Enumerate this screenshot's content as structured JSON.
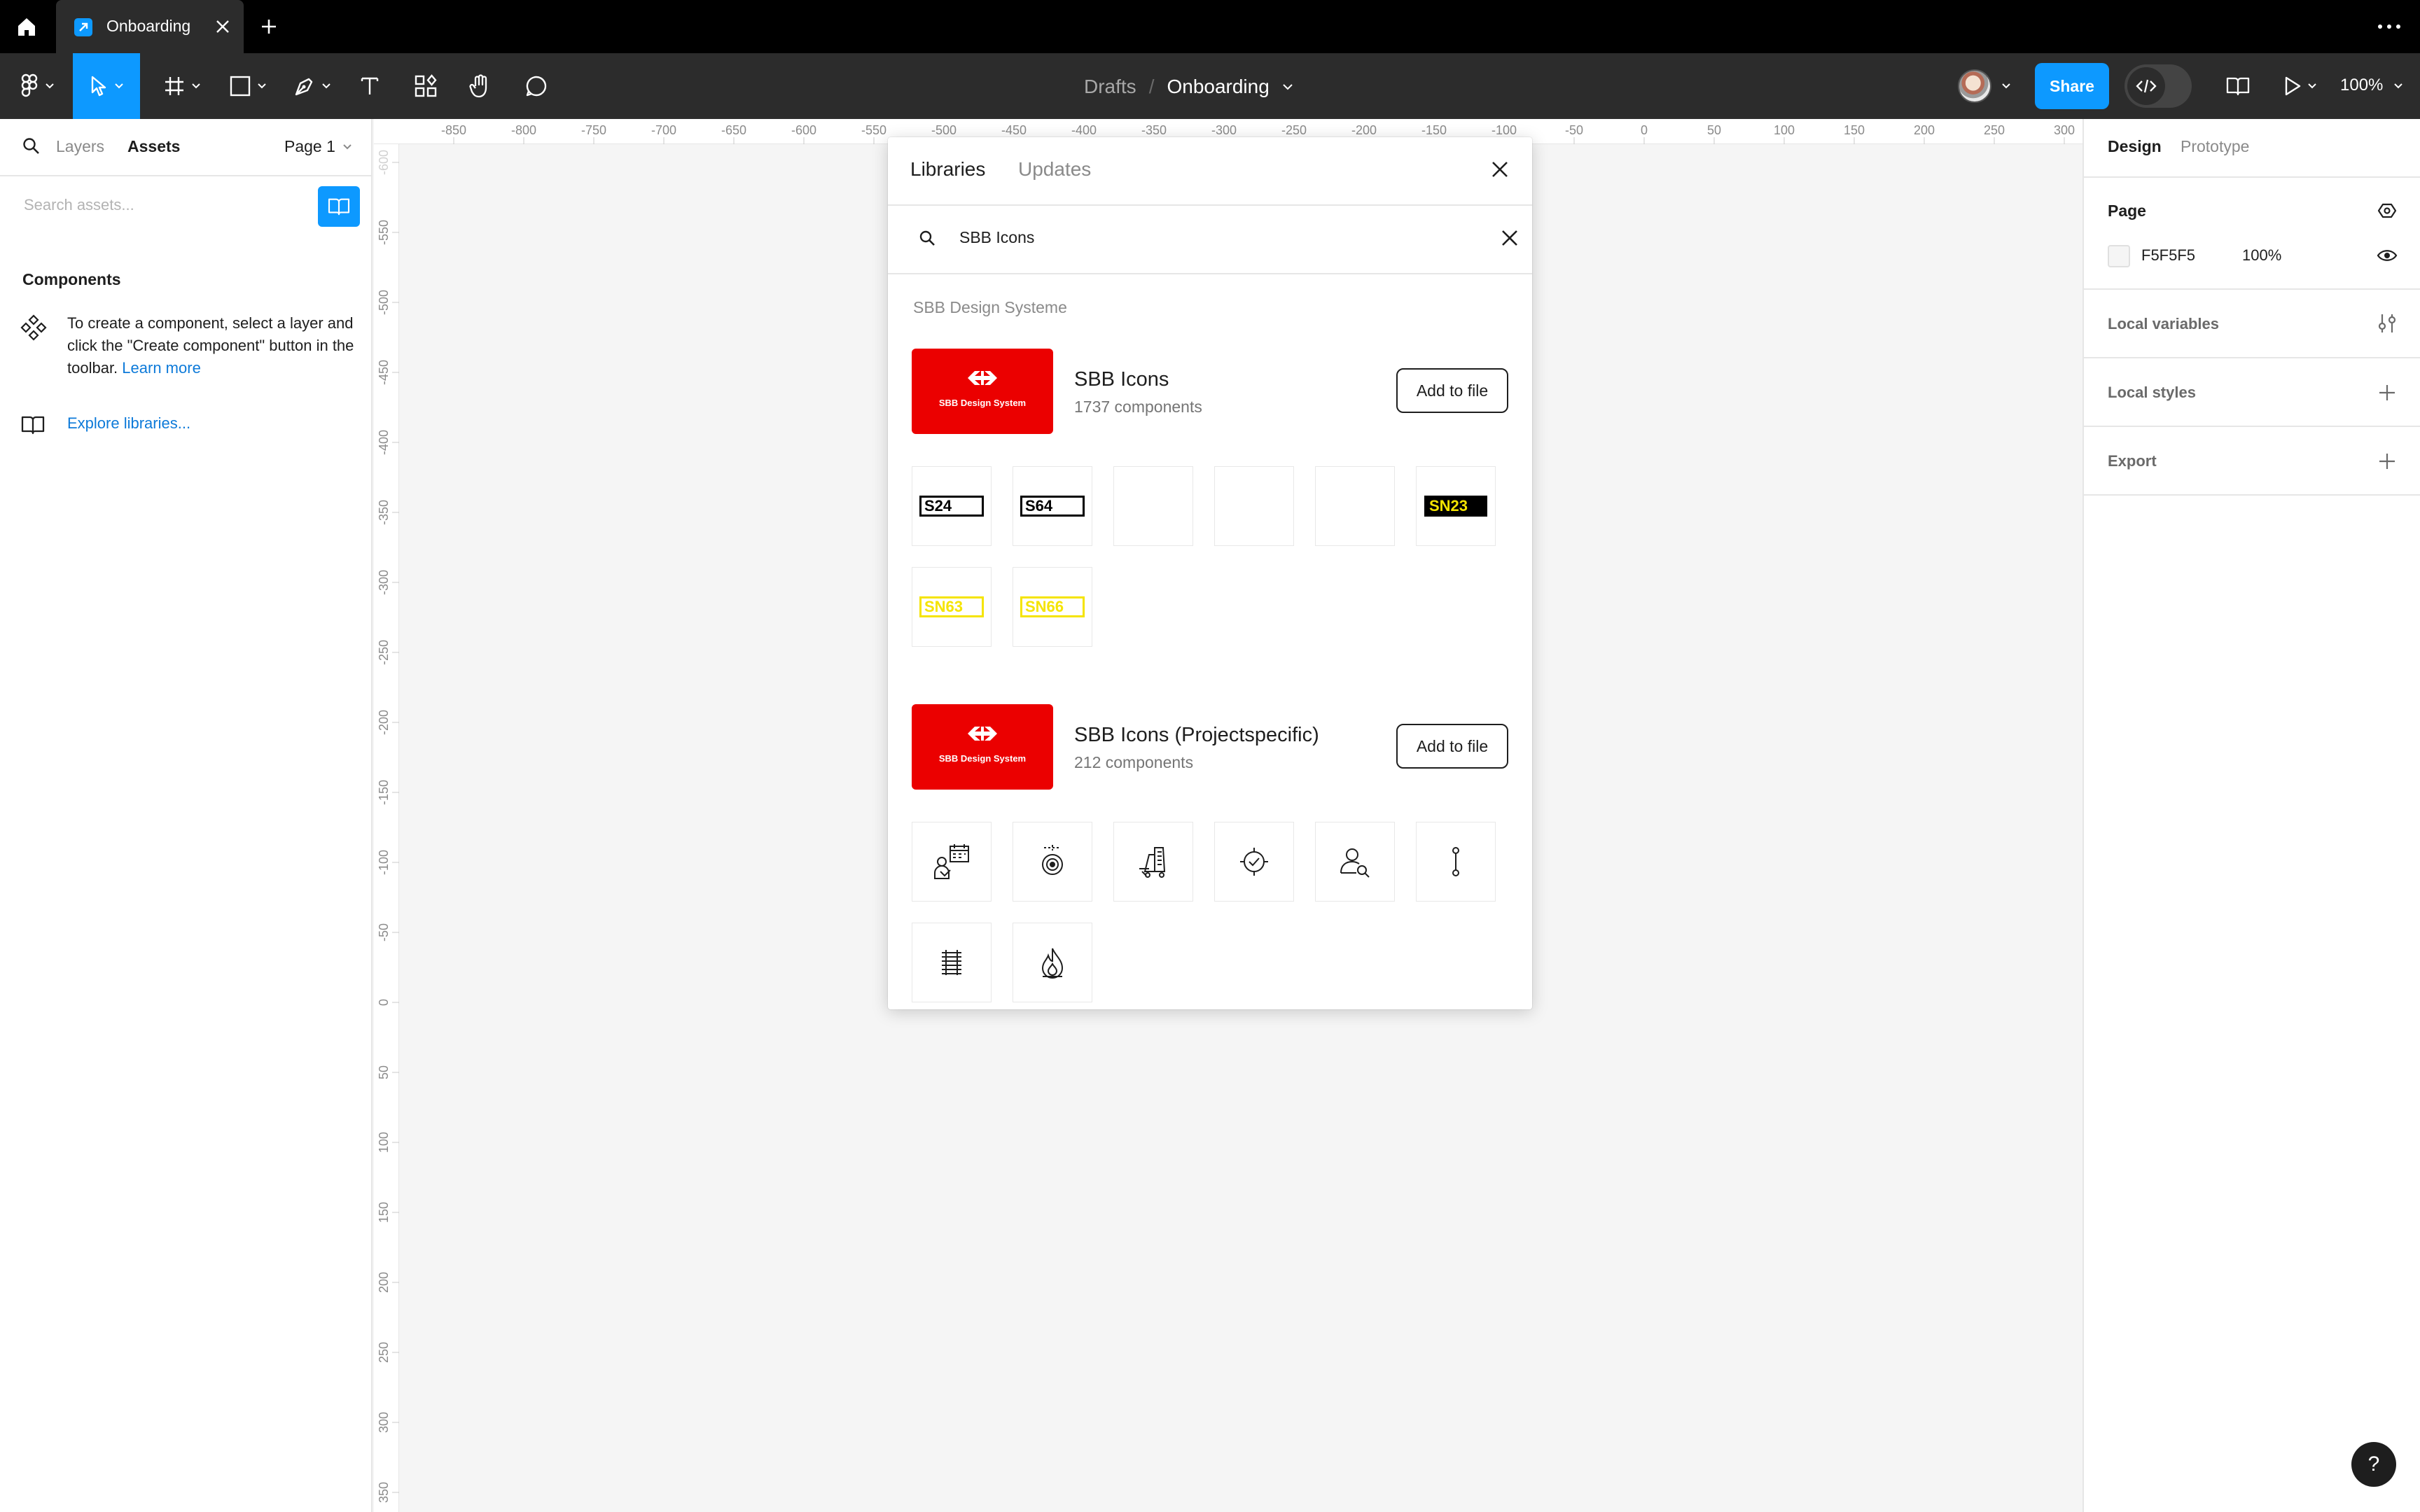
{
  "tabbar": {
    "tab_title": "Onboarding",
    "icons": [
      "home-icon",
      "figma-file-icon",
      "close-icon",
      "plus-icon",
      "more-icon"
    ]
  },
  "toolbar": {
    "breadcrumb": {
      "drafts": "Drafts",
      "separator": "/",
      "file": "Onboarding"
    },
    "share_label": "Share",
    "zoom": "100%",
    "tools": [
      "main-menu",
      "move",
      "frame",
      "shape",
      "pen",
      "text",
      "resources",
      "hand",
      "comment"
    ]
  },
  "left_panel": {
    "tab_layers": "Layers",
    "tab_assets": "Assets",
    "page_selector": "Page 1",
    "search_placeholder": "Search assets...",
    "components_title": "Components",
    "components_help": "To create a component, select a layer and click the \"Create component\" button in the toolbar.",
    "learn_more": "Learn more",
    "explore_libraries": "Explore libraries..."
  },
  "rulers": {
    "top": [
      "-850",
      "-800",
      "-750",
      "-700",
      "-650",
      "-600",
      "-550",
      "-500",
      "-450",
      "-400",
      "-350",
      "-300",
      "-250",
      "-200",
      "-150",
      "-100",
      "-50",
      "0",
      "50",
      "100",
      "150",
      "200",
      "250",
      "300"
    ],
    "left": [
      "-600",
      "-550",
      "-500",
      "-450",
      "-400",
      "-350",
      "-300",
      "-250",
      "-200",
      "-150",
      "-100",
      "-50",
      "0",
      "50",
      "100",
      "150",
      "200",
      "250",
      "300",
      "350"
    ]
  },
  "right_panel": {
    "tab_design": "Design",
    "tab_prototype": "Prototype",
    "page_title": "Page",
    "page_color": "F5F5F5",
    "page_opacity": "100%",
    "local_variables": "Local variables",
    "local_styles": "Local styles",
    "export": "Export"
  },
  "modal": {
    "tab_libraries": "Libraries",
    "tab_updates": "Updates",
    "search_value": "SBB Icons",
    "group_title": "SBB Design Systeme",
    "libraries": [
      {
        "name": "SBB Icons",
        "count": "1737 components",
        "thumb_label": "SBB Design System",
        "add_label": "Add to file",
        "previews": [
          {
            "kind": "sign-white",
            "text": "S24"
          },
          {
            "kind": "sign-white",
            "text": "S64"
          },
          {
            "kind": "blank",
            "text": ""
          },
          {
            "kind": "blank",
            "text": ""
          },
          {
            "kind": "blank",
            "text": ""
          },
          {
            "kind": "sign-black",
            "text": "SN23"
          },
          {
            "kind": "sign-yellow",
            "text": "SN63"
          },
          {
            "kind": "sign-yellow",
            "text": "SN66"
          }
        ]
      },
      {
        "name": "SBB Icons (Projectspecific)",
        "count": "212 components",
        "thumb_label": "SBB Design System",
        "add_label": "Add to file",
        "previews": [
          {
            "kind": "icon",
            "icon": "calendar-person-icon"
          },
          {
            "kind": "icon",
            "icon": "target-icon"
          },
          {
            "kind": "icon",
            "icon": "cart-icon"
          },
          {
            "kind": "icon",
            "icon": "check-badge-icon"
          },
          {
            "kind": "icon",
            "icon": "person-search-icon"
          },
          {
            "kind": "icon",
            "icon": "route-icon"
          },
          {
            "kind": "icon",
            "icon": "rails-icon"
          },
          {
            "kind": "icon",
            "icon": "flame-icon"
          }
        ]
      }
    ]
  },
  "help_label": "?",
  "colors": {
    "accent": "#0d99ff",
    "sbb_red": "#eb0000",
    "sign_yellow": "#f5e400",
    "dark_chrome": "#2c2c2c"
  }
}
